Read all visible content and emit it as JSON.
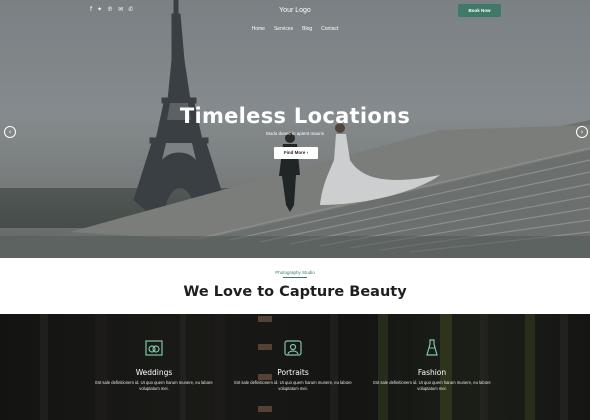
{
  "header": {
    "social_icons": [
      "facebook-icon",
      "twitter-icon",
      "pinterest-icon",
      "mail-icon",
      "phone-icon"
    ],
    "logo": "Your Logo",
    "book_button": "Book Now",
    "nav": [
      "Home",
      "Services",
      "Blog",
      "Contact"
    ]
  },
  "hero": {
    "title": "Timeless Locations",
    "subtitle": "Modo donec in aptent mauris",
    "button": "Find More",
    "button_arrow": "›",
    "prev_arrow": "‹",
    "next_arrow": "›"
  },
  "intro": {
    "eyebrow": "Photography Studio",
    "headline": "We Love to Capture Beauty"
  },
  "services": [
    {
      "title": "Weddings",
      "icon": "rings-icon",
      "desc": "Est sale definitionem id. Ut quo quem harum munere, eu labore voluptatum mei."
    },
    {
      "title": "Portraits",
      "icon": "portrait-frame-icon",
      "desc": "Est sale definitionem id. Ut quo quem harum munere, eu labore voluptatum mei."
    },
    {
      "title": "Fashion",
      "icon": "dress-icon",
      "desc": "Est sale definitionem id. Ut quo quem harum munere, eu labore voluptatum mei."
    }
  ],
  "colors": {
    "accent": "#3e7a67",
    "white": "#ffffff",
    "dark_text": "#1f1f1f"
  }
}
